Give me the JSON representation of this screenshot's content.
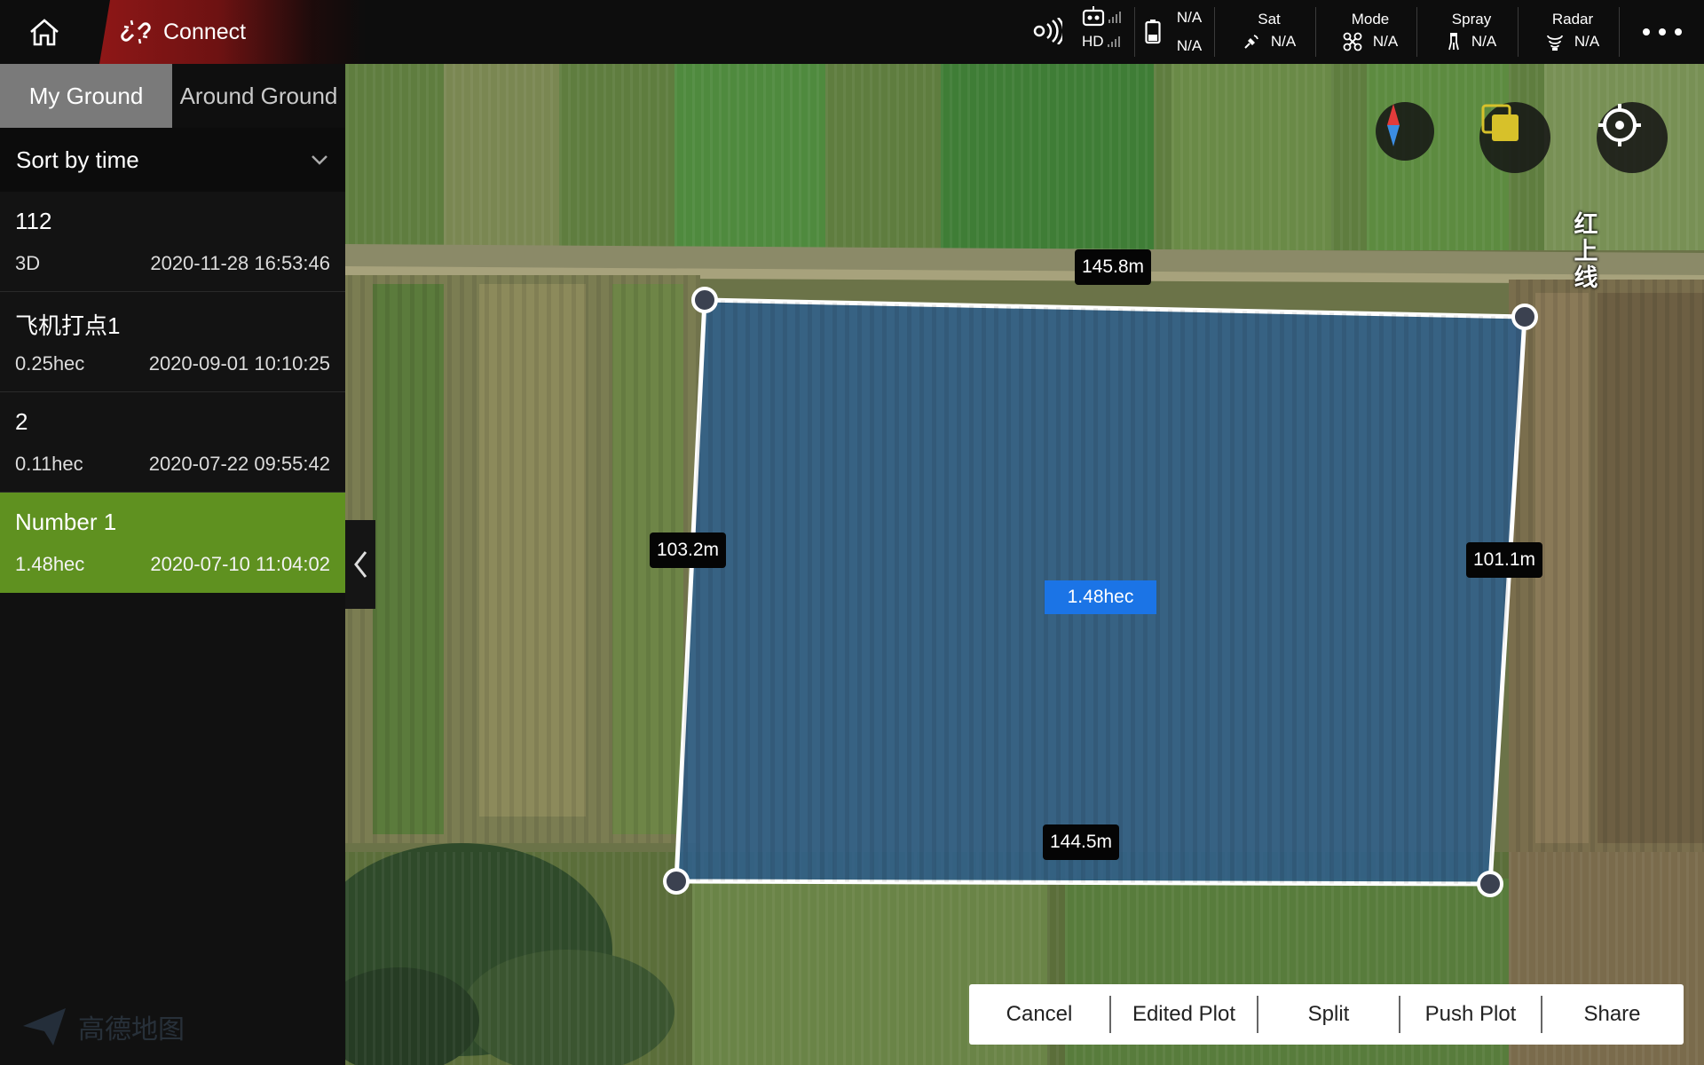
{
  "topbar": {
    "connect_label": "Connect",
    "remote_hd_label": "HD",
    "battery": {
      "line1": "N/A",
      "line2": "N/A"
    },
    "sat": {
      "title": "Sat",
      "value": "N/A"
    },
    "mode": {
      "title": "Mode",
      "value": "N/A"
    },
    "spray": {
      "title": "Spray",
      "value": "N/A"
    },
    "radar": {
      "title": "Radar",
      "value": "N/A"
    }
  },
  "left_panel": {
    "tabs": [
      {
        "label": "My Ground",
        "active": true
      },
      {
        "label": "Around Ground",
        "active": false
      }
    ],
    "sort_label": "Sort by time",
    "plots": [
      {
        "name": "112",
        "sub": "3D",
        "date": "2020-11-28 16:53:46",
        "selected": false
      },
      {
        "name": "飞机打点1",
        "sub": "0.25hec",
        "date": "2020-09-01 10:10:25",
        "selected": false
      },
      {
        "name": "2",
        "sub": "0.11hec",
        "date": "2020-07-22 09:55:42",
        "selected": false
      },
      {
        "name": "Number 1",
        "sub": "1.48hec",
        "date": "2020-07-10 11:04:02",
        "selected": true
      }
    ]
  },
  "map": {
    "edges": {
      "top": "145.8m",
      "left": "103.2m",
      "right": "101.1m",
      "bottom": "144.5m"
    },
    "area": "1.48hec",
    "road_label": "红上线",
    "colors": {
      "plot_fill": "#2e5f8e",
      "area_badge": "#1b74e6",
      "selected_item": "#5f9120"
    }
  },
  "actions": {
    "cancel": "Cancel",
    "edited_plot": "Edited Plot",
    "split": "Split",
    "push_plot": "Push Plot",
    "share": "Share"
  },
  "watermark": "高德地图"
}
